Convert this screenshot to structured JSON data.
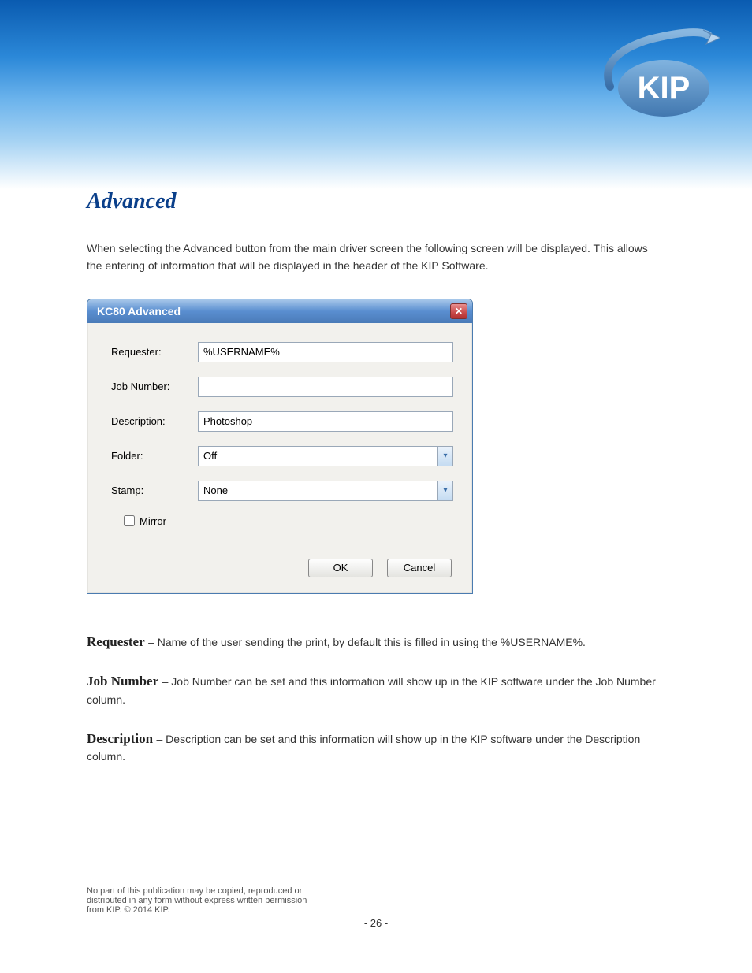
{
  "header": {
    "logo_text": "KIP"
  },
  "page": {
    "title": "Advanced",
    "intro": "When selecting the Advanced button from the main driver screen the following screen will be displayed. This allows the entering of information that will be displayed in the header of the KIP Software.",
    "dialog": {
      "title": "KC80 Advanced",
      "requester_label": "Requester:",
      "requester_value": "%USERNAME%",
      "jobnumber_label": "Job Number:",
      "jobnumber_value": "",
      "description_label": "Description:",
      "description_value": "Photoshop",
      "folder_label": "Folder:",
      "folder_value": "Off",
      "stamp_label": "Stamp:",
      "stamp_value": "None",
      "mirror_label": "Mirror",
      "ok": "OK",
      "cancel": "Cancel"
    },
    "defs": {
      "requester_h": "Requester",
      "requester_t": " – Name of the user sending the print, by default this is filled in using the %USERNAME%.",
      "jobnumber_h": "Job Number",
      "jobnumber_t": " – Job Number can be set and this information will show up in the KIP software under the Job Number column.",
      "description_h": "Description",
      "description_t": " – Description can be set and this information will show up in the KIP software under the Description column."
    }
  },
  "footer": {
    "line": "No part of this publication may be copied, reproduced or distributed in any form without express written permission from KIP. © 2014 KIP.",
    "page": "- 26 -"
  }
}
